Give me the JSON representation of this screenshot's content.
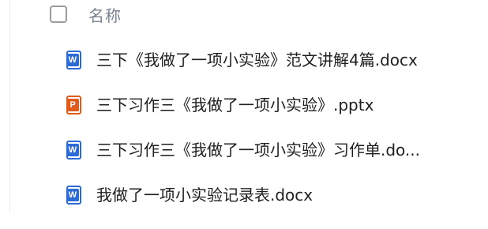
{
  "header": {
    "column_title": "名称"
  },
  "files": [
    {
      "icon": "word-doc-icon",
      "badge": "W",
      "name": "三下《我做了一项小实验》范文讲解4篇.docx"
    },
    {
      "icon": "ppt-icon",
      "badge": "P",
      "name": "三下习作三《我做了一项小实验》.pptx"
    },
    {
      "icon": "word-doc-icon",
      "badge": "W",
      "name": "三下习作三《我做了一项小实验》习作单.do..."
    },
    {
      "icon": "word-doc-icon",
      "badge": "W",
      "name": "我做了一项小实验记录表.docx"
    }
  ],
  "colors": {
    "word": "#2c6bd7",
    "ppt": "#e35b1b",
    "header_text": "#7a8391"
  }
}
